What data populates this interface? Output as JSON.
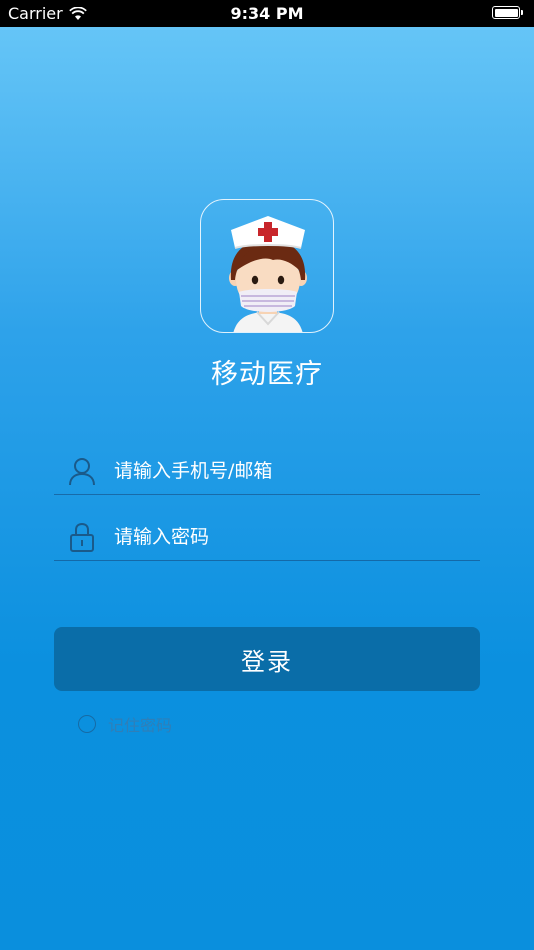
{
  "status_bar": {
    "carrier": "Carrier",
    "time": "9:34 PM"
  },
  "app": {
    "name": "移动医疗",
    "logo_icon": "nurse-avatar-icon"
  },
  "form": {
    "username_placeholder": "请输入手机号/邮箱",
    "password_placeholder": "请输入密码",
    "login_label": "登录",
    "remember_label": "记住密码",
    "remember_checked": false
  },
  "colors": {
    "gradient_top": "#6ac8f8",
    "gradient_bottom": "#0a8fdd",
    "button": "#0a6da8",
    "line": "#1a5a8a"
  }
}
